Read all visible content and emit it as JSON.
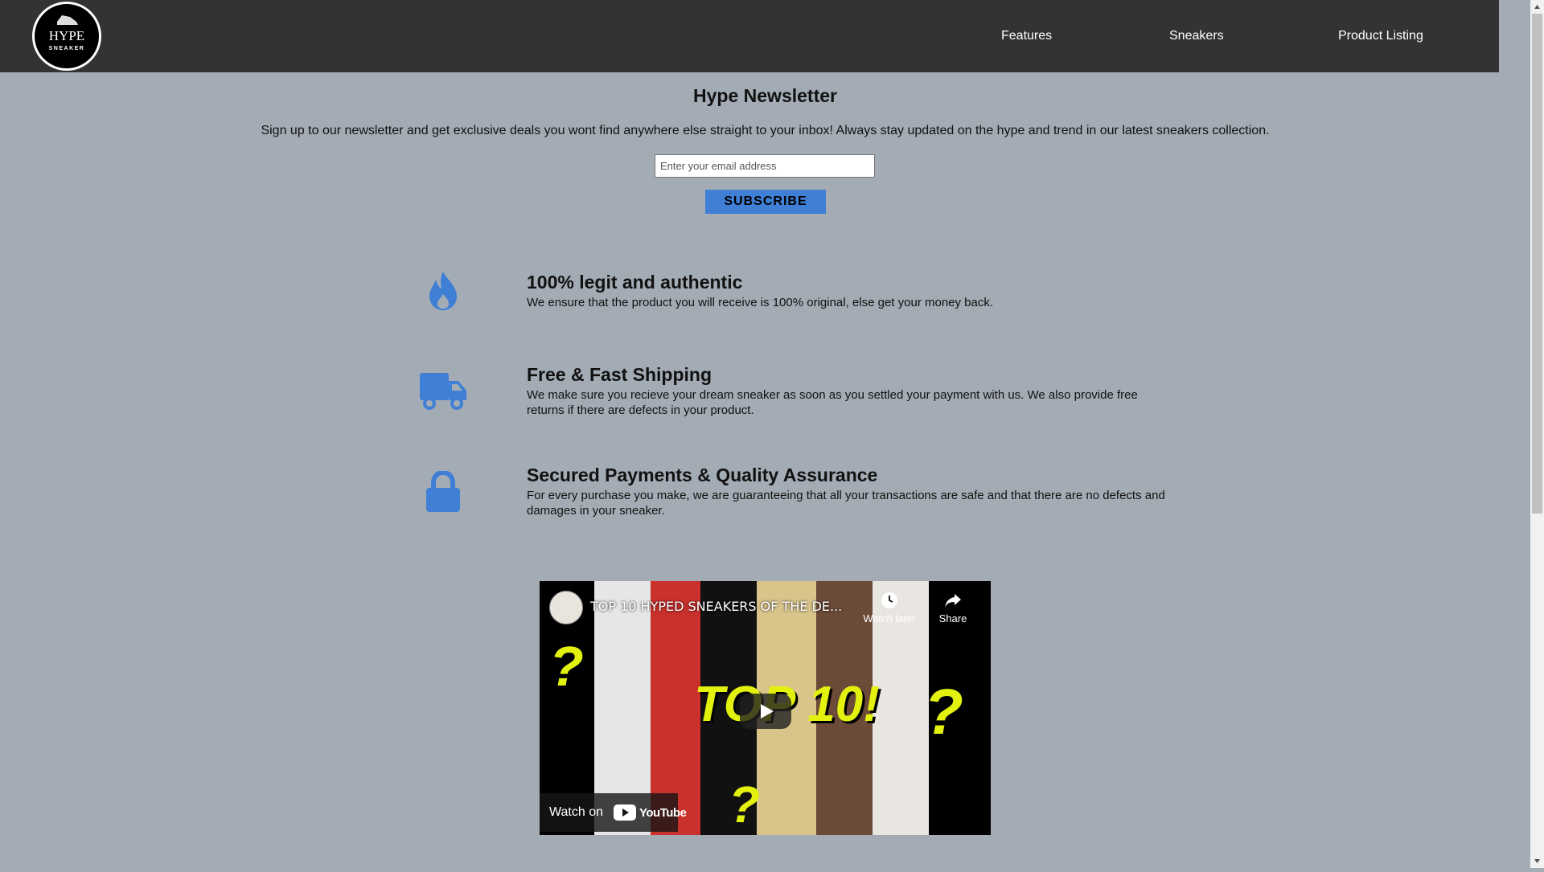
{
  "header": {
    "logo": {
      "line1": "HYPE",
      "line2": "SNEAKER"
    },
    "nav": [
      {
        "label": "Features"
      },
      {
        "label": "Sneakers"
      },
      {
        "label": "Product Listing"
      }
    ]
  },
  "newsletter": {
    "title": "Hype Newsletter",
    "description": "Sign up to our newsletter and get exclusive deals you wont find anywhere else straight to your inbox! Always stay updated on the hype and trend in our latest sneakers collection.",
    "email_placeholder": "Enter your email address",
    "email_value": "",
    "subscribe_label": "SUBSCRIBE"
  },
  "features": [
    {
      "icon": "fire-icon",
      "title": "100% legit and authentic",
      "desc": "We ensure that the product you will receive is 100% original, else get your money back."
    },
    {
      "icon": "truck-icon",
      "title": "Free & Fast Shipping",
      "desc": "We make sure you recieve your dream sneaker as soon as you settled your payment with us. We also provide free returns if there are defects in your product."
    },
    {
      "icon": "lock-icon",
      "title": "Secured Payments & Quality Assurance",
      "desc": "For every purchase you make, we are guaranteeing that all your transactions are safe and that there are no defects and damages in your sneaker."
    }
  ],
  "video": {
    "title": "TOP 10 HYPED SNEAKERS OF THE DE...",
    "watch_later": "Watch later",
    "share": "Share",
    "watch_on": "Watch on",
    "youtube": "YouTube",
    "thumb_text": "TOP 10!"
  },
  "colors": {
    "accent": "#3f7fd6",
    "header_bg": "#333333",
    "page_bg": "#a3acb4"
  }
}
